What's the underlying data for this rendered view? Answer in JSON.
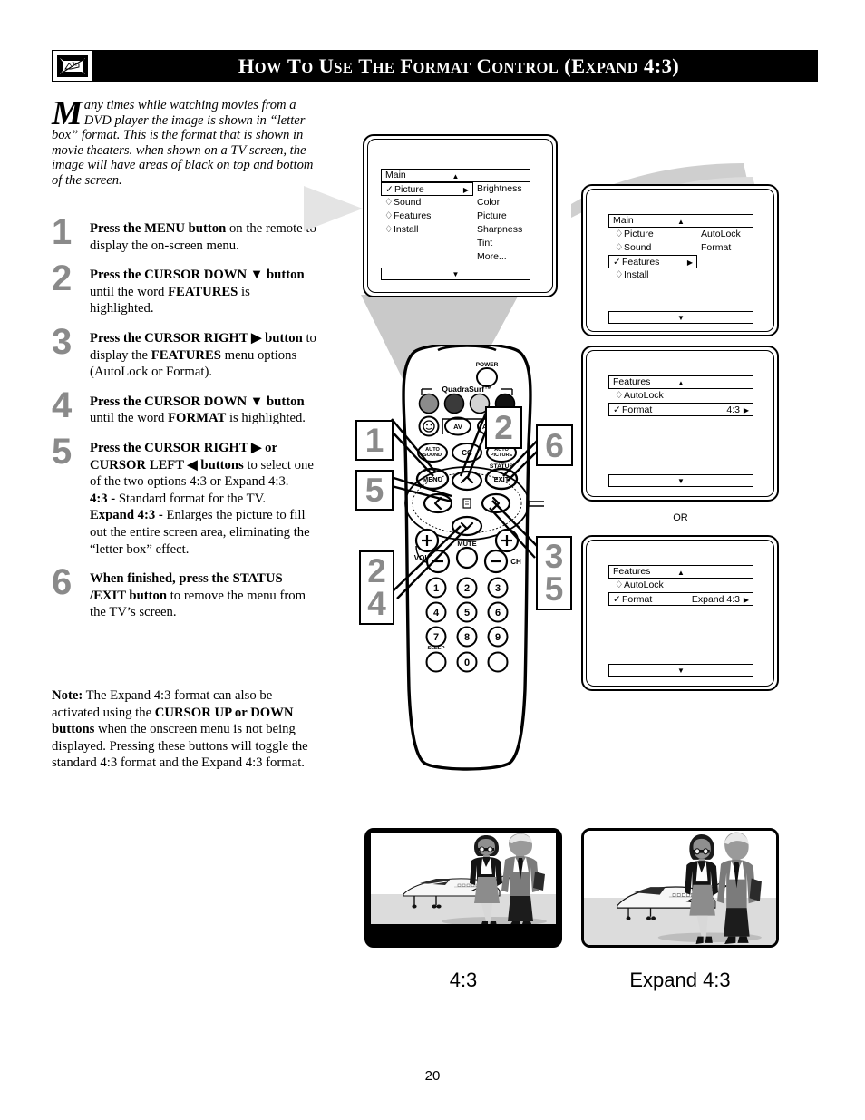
{
  "header": {
    "icon": "tv-hand-icon",
    "title_parts": [
      {
        "t": "H",
        "big": true
      },
      {
        "t": "OW",
        "big": false
      },
      {
        "t": " ",
        "big": true
      },
      {
        "t": "T",
        "big": true
      },
      {
        "t": "O",
        "big": false
      },
      {
        "t": " ",
        "big": true
      },
      {
        "t": "U",
        "big": true
      },
      {
        "t": "SE",
        "big": false
      },
      {
        "t": " ",
        "big": true
      },
      {
        "t": "T",
        "big": true
      },
      {
        "t": "HE",
        "big": false
      },
      {
        "t": " ",
        "big": true
      },
      {
        "t": "F",
        "big": true
      },
      {
        "t": "ORMAT",
        "big": false
      },
      {
        "t": " ",
        "big": true
      },
      {
        "t": "C",
        "big": true
      },
      {
        "t": "ONTROL",
        "big": false
      },
      {
        "t": " (",
        "big": true
      },
      {
        "t": "E",
        "big": true
      },
      {
        "t": "XPAND",
        "big": false
      },
      {
        "t": " 4:3)",
        "big": true
      }
    ],
    "title_plain": "HOW TO USE THE FORMAT CONTROL (EXPAND 4:3)",
    "bg_color": "#000000",
    "text_color": "#ffffff"
  },
  "intro": {
    "dropcap": "M",
    "text": "any times while watching movies from a DVD player the image is shown in “letter box” format. This is the format that is shown in movie theaters. when shown on a TV screen, the image will have areas of black on top and bottom of the screen."
  },
  "steps": [
    {
      "num": "1",
      "html": "<b>Press the MENU button</b> on the remote to display the on-screen menu."
    },
    {
      "num": "2",
      "html": "<b>Press the CURSOR DOWN ▼ button</b> until the word <b>FEATURES</b> is highlighted."
    },
    {
      "num": "3",
      "html": "<b>Press the CURSOR RIGHT ▶ button</b> to display the <b>FEATURES</b> menu options (AutoLock or Format)."
    },
    {
      "num": "4",
      "html": "<b>Press the CURSOR DOWN ▼ button</b> until the word <b>FORMAT</b> is highlighted."
    },
    {
      "num": "5",
      "html": "<b>Press the CURSOR RIGHT ▶ or CURSOR LEFT ◀ buttons</b> to select one of the two options 4:3 or Expand 4:3.<br><b>4:3 -</b> Standard format for the TV.<br><b>Expand 4:3 -</b> Enlarges the picture to fill out the entire screen area, eliminating the “letter box” effect."
    },
    {
      "num": "6",
      "html": "<b>When finished, press the STATUS /EXIT button</b> to remove the menu from the TV’s screen."
    }
  ],
  "note": {
    "html": "<b>Note:</b> The Expand 4:3 format can also be activated using the <b>CURSOR UP or DOWN buttons</b> when the onscreen menu is not being displayed. Pressing these buttons will toggle the standard 4:3 format and the Expand 4:3 format."
  },
  "menus": {
    "main_picture": {
      "title": "Main",
      "up_arrow": "▲",
      "down_arrow": "▼",
      "items": [
        {
          "mark": "✓",
          "label": "Picture",
          "selected": true,
          "arrow": "▶"
        },
        {
          "mark": "♢",
          "label": "Sound",
          "selected": false,
          "arrow": ""
        },
        {
          "mark": "♢",
          "label": "Features",
          "selected": false,
          "arrow": ""
        },
        {
          "mark": "♢",
          "label": "Install",
          "selected": false,
          "arrow": ""
        }
      ],
      "subitems": [
        "Brightness",
        "Color",
        "Picture",
        "Sharpness",
        "Tint",
        "More..."
      ]
    },
    "main_features": {
      "title": "Main",
      "up_arrow": "▲",
      "down_arrow": "▼",
      "items": [
        {
          "mark": "♢",
          "label": "Picture",
          "selected": false,
          "arrow": ""
        },
        {
          "mark": "♢",
          "label": "Sound",
          "selected": false,
          "arrow": ""
        },
        {
          "mark": "✓",
          "label": "Features",
          "selected": true,
          "arrow": "▶"
        },
        {
          "mark": "♢",
          "label": "Install",
          "selected": false,
          "arrow": ""
        }
      ],
      "subitems": [
        "AutoLock",
        "Format"
      ]
    },
    "features_43": {
      "title": "Features",
      "up_arrow": "▲",
      "down_arrow": "▼",
      "items": [
        {
          "mark": "♢",
          "label": "AutoLock",
          "selected": false,
          "value": "",
          "arrow": ""
        },
        {
          "mark": "✓",
          "label": "Format",
          "selected": true,
          "value": "4:3",
          "arrow": "▶"
        }
      ]
    },
    "features_expand": {
      "title": "Features",
      "up_arrow": "▲",
      "down_arrow": "▼",
      "items": [
        {
          "mark": "♢",
          "label": "AutoLock",
          "selected": false,
          "value": "",
          "arrow": ""
        },
        {
          "mark": "✓",
          "label": "Format",
          "selected": true,
          "value": "Expand 4:3",
          "arrow": "▶"
        }
      ]
    },
    "or_label": "OR"
  },
  "remote": {
    "power_label": "POWER",
    "quadrasurf_label": "QuadraSurf™",
    "buttons": [
      {
        "name": "smiley",
        "label": "☺"
      },
      {
        "name": "av",
        "label": "AV"
      },
      {
        "name": "ach",
        "label": "A/CH"
      },
      {
        "name": "auto-sound",
        "label": "AUTO SOUND"
      },
      {
        "name": "cc",
        "label": "CC"
      },
      {
        "name": "auto-picture",
        "label": "AUTO PICTURE"
      },
      {
        "name": "menu",
        "label": "MENU"
      },
      {
        "name": "status-exit",
        "label": "EXIT"
      }
    ],
    "status_label": "STATUS",
    "mute_label": "MUTE",
    "vol_label": "VOL",
    "ch_label": "CH",
    "sleep_label": "SLEEP",
    "keypad": [
      "1",
      "2",
      "3",
      "4",
      "5",
      "6",
      "7",
      "8",
      "9",
      "0"
    ],
    "cursor": {
      "up": "∧",
      "down": "∨",
      "left": "〈",
      "right": "〉"
    }
  },
  "callouts": [
    {
      "id": "callout-1",
      "numbers": [
        "1"
      ]
    },
    {
      "id": "callout-5",
      "numbers": [
        "5"
      ]
    },
    {
      "id": "callout-2-4",
      "numbers": [
        "2",
        "4"
      ]
    },
    {
      "id": "callout-2",
      "numbers": [
        "2"
      ]
    },
    {
      "id": "callout-6",
      "numbers": [
        "6"
      ]
    },
    {
      "id": "callout-3-5",
      "numbers": [
        "3",
        "5"
      ]
    }
  ],
  "comparison": {
    "left": {
      "caption": "4:3",
      "mode": "letterbox"
    },
    "right": {
      "caption": "Expand 4:3",
      "mode": "expanded"
    }
  },
  "page_number": "20",
  "colors": {
    "header_bg": "#000000",
    "step_number": "#8a8a8a",
    "beam_gray": "#c9c9c9",
    "beam_gray_light": "#e2e2e2",
    "picture_gray": "#d9d9d9",
    "picture_mid": "#8d8d8d",
    "picture_dark": "#1a1a1a"
  }
}
